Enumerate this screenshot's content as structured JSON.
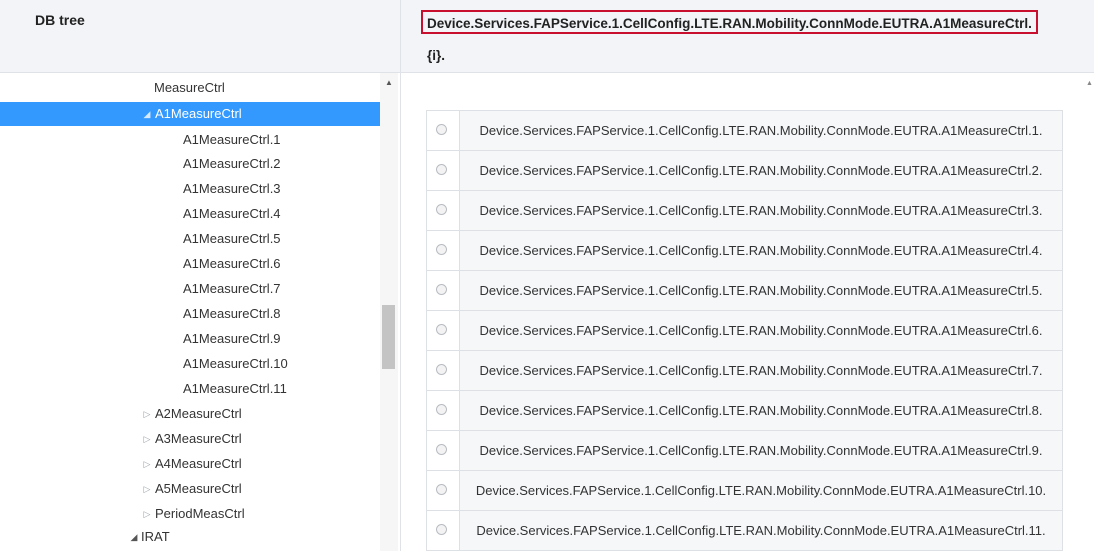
{
  "left_panel": {
    "title": "DB tree"
  },
  "tree": {
    "items": [
      {
        "label": "MeasureCtrl",
        "arrow": ""
      },
      {
        "label": "A1MeasureCtrl",
        "arrow": "◢",
        "selected": true
      },
      {
        "label": "A1MeasureCtrl.1",
        "arrow": ""
      },
      {
        "label": "A1MeasureCtrl.2",
        "arrow": ""
      },
      {
        "label": "A1MeasureCtrl.3",
        "arrow": ""
      },
      {
        "label": "A1MeasureCtrl.4",
        "arrow": ""
      },
      {
        "label": "A1MeasureCtrl.5",
        "arrow": ""
      },
      {
        "label": "A1MeasureCtrl.6",
        "arrow": ""
      },
      {
        "label": "A1MeasureCtrl.7",
        "arrow": ""
      },
      {
        "label": "A1MeasureCtrl.8",
        "arrow": ""
      },
      {
        "label": "A1MeasureCtrl.9",
        "arrow": ""
      },
      {
        "label": "A1MeasureCtrl.10",
        "arrow": ""
      },
      {
        "label": "A1MeasureCtrl.11",
        "arrow": ""
      },
      {
        "label": "A2MeasureCtrl",
        "arrow": "▷"
      },
      {
        "label": "A3MeasureCtrl",
        "arrow": "▷"
      },
      {
        "label": "A4MeasureCtrl",
        "arrow": "▷"
      },
      {
        "label": "A5MeasureCtrl",
        "arrow": "▷"
      },
      {
        "label": "PeriodMeasCtrl",
        "arrow": "▷"
      },
      {
        "label": "IRAT",
        "arrow": "◢"
      }
    ]
  },
  "right_panel": {
    "path": "Device.Services.FAPService.1.CellConfig.LTE.RAN.Mobility.ConnMode.EUTRA.A1MeasureCtrl.",
    "path_suffix": "{i}."
  },
  "instances": [
    "Device.Services.FAPService.1.CellConfig.LTE.RAN.Mobility.ConnMode.EUTRA.A1MeasureCtrl.1.",
    "Device.Services.FAPService.1.CellConfig.LTE.RAN.Mobility.ConnMode.EUTRA.A1MeasureCtrl.2.",
    "Device.Services.FAPService.1.CellConfig.LTE.RAN.Mobility.ConnMode.EUTRA.A1MeasureCtrl.3.",
    "Device.Services.FAPService.1.CellConfig.LTE.RAN.Mobility.ConnMode.EUTRA.A1MeasureCtrl.4.",
    "Device.Services.FAPService.1.CellConfig.LTE.RAN.Mobility.ConnMode.EUTRA.A1MeasureCtrl.5.",
    "Device.Services.FAPService.1.CellConfig.LTE.RAN.Mobility.ConnMode.EUTRA.A1MeasureCtrl.6.",
    "Device.Services.FAPService.1.CellConfig.LTE.RAN.Mobility.ConnMode.EUTRA.A1MeasureCtrl.7.",
    "Device.Services.FAPService.1.CellConfig.LTE.RAN.Mobility.ConnMode.EUTRA.A1MeasureCtrl.8.",
    "Device.Services.FAPService.1.CellConfig.LTE.RAN.Mobility.ConnMode.EUTRA.A1MeasureCtrl.9.",
    "Device.Services.FAPService.1.CellConfig.LTE.RAN.Mobility.ConnMode.EUTRA.A1MeasureCtrl.10.",
    "Device.Services.FAPService.1.CellConfig.LTE.RAN.Mobility.ConnMode.EUTRA.A1MeasureCtrl.11."
  ],
  "colors": {
    "selected_bg": "#3399ff",
    "highlight_border": "#c8102e",
    "header_bg": "#f2f4f7"
  }
}
